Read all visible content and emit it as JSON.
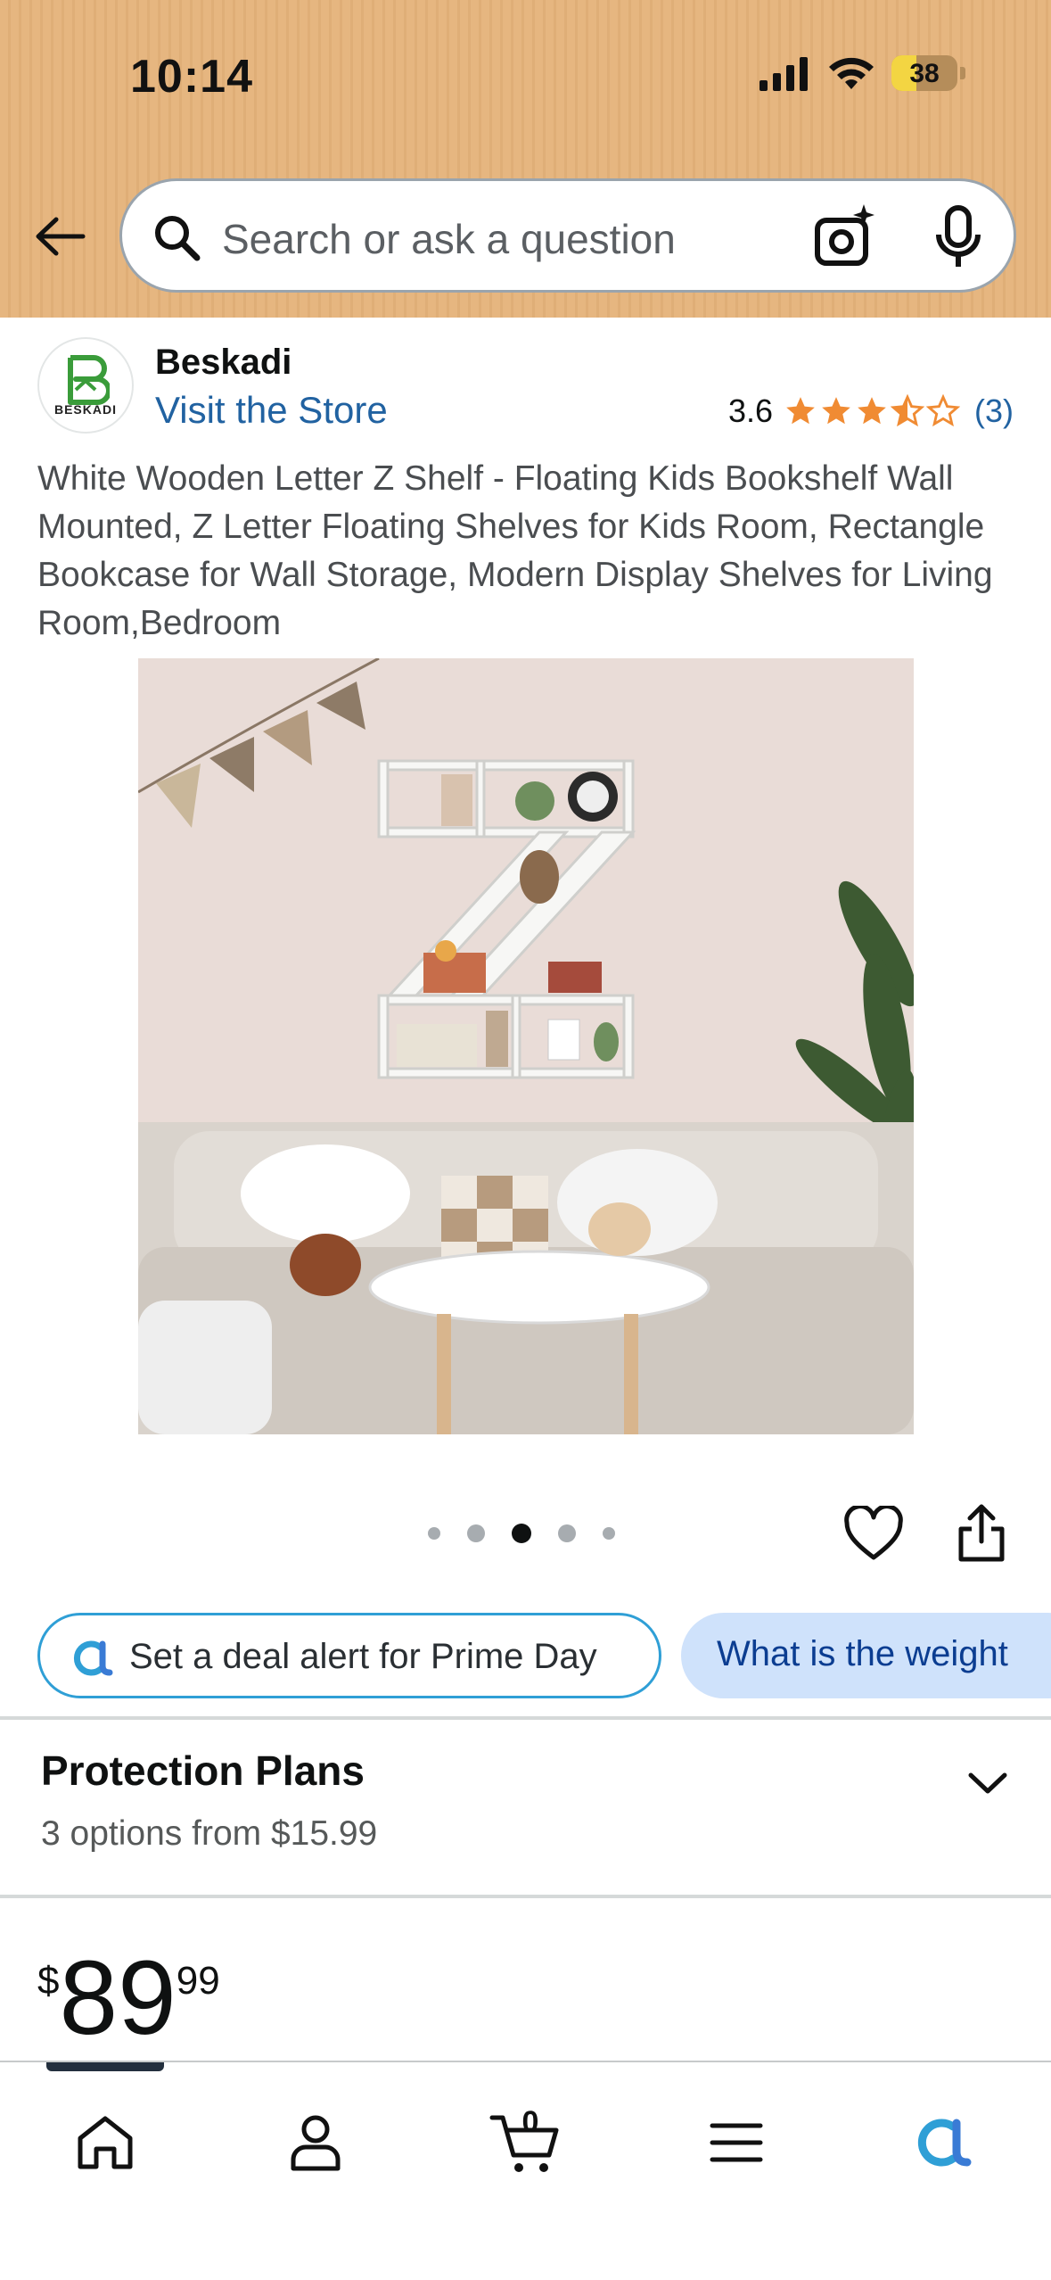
{
  "status_bar": {
    "time": "10:14",
    "battery_level": "38",
    "icons": [
      "cellular-signal-icon",
      "wifi-icon",
      "battery-icon"
    ]
  },
  "header": {
    "back_icon": "back-arrow-icon",
    "search_placeholder": "Search or ask a question",
    "search_icon": "search-icon",
    "camera_icon": "camera-sparkle-icon",
    "mic_icon": "microphone-icon"
  },
  "brand": {
    "name": "Beskadi",
    "logo_text": "BESKADI",
    "visit_store": "Visit the Store",
    "rating_value": "3.6",
    "rating_fraction": 0.72,
    "rating_count": "(3)"
  },
  "product": {
    "title": "White Wooden Letter Z Shelf - Floating Kids Bookshelf Wall Mounted, Z Letter Floating Shelves for Kids Room, Rectangle Bookcase for Wall Storage, Modern Display Shelves for Living Room,Bedroom",
    "image_count": 5,
    "active_image_index": 2
  },
  "actions": {
    "wishlist_icon": "heart-icon",
    "share_icon": "share-icon"
  },
  "chips": {
    "deal_alert": "Set a deal alert for Prime Day",
    "question": "What is the weight"
  },
  "protection": {
    "title": "Protection Plans",
    "subtitle": "3 options from $15.99"
  },
  "price": {
    "symbol": "$",
    "whole": "89",
    "fraction": "99"
  },
  "bottom_nav": {
    "items": [
      "home-icon",
      "account-icon",
      "cart-icon",
      "menu-icon",
      "rufus-icon"
    ],
    "cart_count": "0"
  },
  "colors": {
    "header_bg": "#e6b680",
    "link": "#2162a1",
    "star": "#f08b33",
    "chip_border": "#2f9fd6",
    "chip_question_bg": "#cfe2fb"
  }
}
